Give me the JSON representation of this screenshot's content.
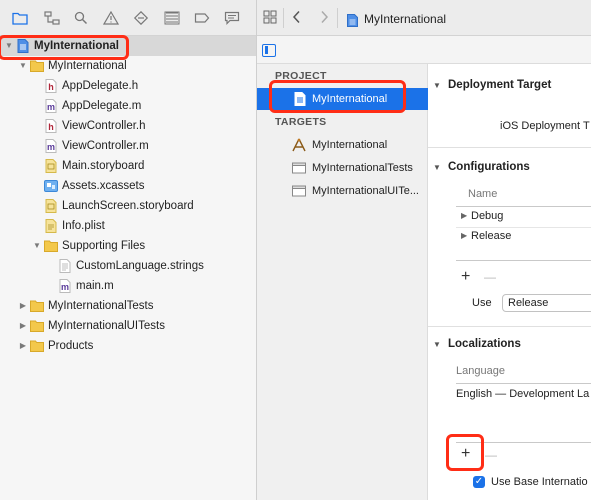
{
  "colors": {
    "accent": "#1b72e8",
    "highlight": "#ff2d16",
    "folder": "#f3c84b",
    "header_h": "#b0263a",
    "impl_m": "#5a3b9a"
  },
  "navigator": {
    "toolbar_icons": [
      "folder-icon",
      "source-control-icon",
      "search-icon",
      "issue-icon",
      "test-icon",
      "debug-icon",
      "breakpoint-icon",
      "report-icon"
    ],
    "tree": [
      {
        "label": "MyInternational",
        "icon": "project-file-icon",
        "indent": 0,
        "expanded": true,
        "root": true
      },
      {
        "label": "MyInternational",
        "icon": "folder-icon",
        "indent": 1,
        "expanded": true
      },
      {
        "label": "AppDelegate.h",
        "icon": "header-file-icon",
        "indent": 2
      },
      {
        "label": "AppDelegate.m",
        "icon": "implementation-file-icon",
        "indent": 2
      },
      {
        "label": "ViewController.h",
        "icon": "header-file-icon",
        "indent": 2
      },
      {
        "label": "ViewController.m",
        "icon": "implementation-file-icon",
        "indent": 2
      },
      {
        "label": "Main.storyboard",
        "icon": "storyboard-file-icon",
        "indent": 2
      },
      {
        "label": "Assets.xcassets",
        "icon": "asset-catalog-icon",
        "indent": 2
      },
      {
        "label": "LaunchScreen.storyboard",
        "icon": "storyboard-file-icon",
        "indent": 2
      },
      {
        "label": "Info.plist",
        "icon": "plist-file-icon",
        "indent": 2
      },
      {
        "label": "Supporting Files",
        "icon": "folder-icon",
        "indent": 2,
        "expanded": true
      },
      {
        "label": "CustomLanguage.strings",
        "icon": "strings-file-icon",
        "indent": 3
      },
      {
        "label": "main.m",
        "icon": "implementation-file-icon",
        "indent": 3
      },
      {
        "label": "MyInternationalTests",
        "icon": "folder-icon",
        "indent": 1,
        "expanded": false
      },
      {
        "label": "MyInternationalUITests",
        "icon": "folder-icon",
        "indent": 1,
        "expanded": false
      },
      {
        "label": "Products",
        "icon": "folder-icon",
        "indent": 1,
        "expanded": false
      }
    ]
  },
  "jump_bar": {
    "title": "MyInternational"
  },
  "project_list": {
    "project_header": "PROJECT",
    "project_item": "MyInternational",
    "targets_header": "TARGETS",
    "targets": [
      {
        "label": "MyInternational",
        "icon": "app-target-icon"
      },
      {
        "label": "MyInternationalTests",
        "icon": "test-target-icon"
      },
      {
        "label": "MyInternationalUITe...",
        "icon": "test-target-icon"
      }
    ]
  },
  "settings": {
    "deployment": {
      "title": "Deployment Target",
      "ios_label": "iOS Deployment T"
    },
    "configurations": {
      "title": "Configurations",
      "name_header": "Name",
      "rows": [
        "Debug",
        "Release"
      ],
      "add": "+",
      "remove": "—",
      "use_label": "Use",
      "use_value": "Release"
    },
    "localizations": {
      "title": "Localizations",
      "language_header": "Language",
      "rows": [
        "English — Development La"
      ],
      "add": "+",
      "remove": "—",
      "base_checkbox": "Use Base Internatio"
    }
  }
}
